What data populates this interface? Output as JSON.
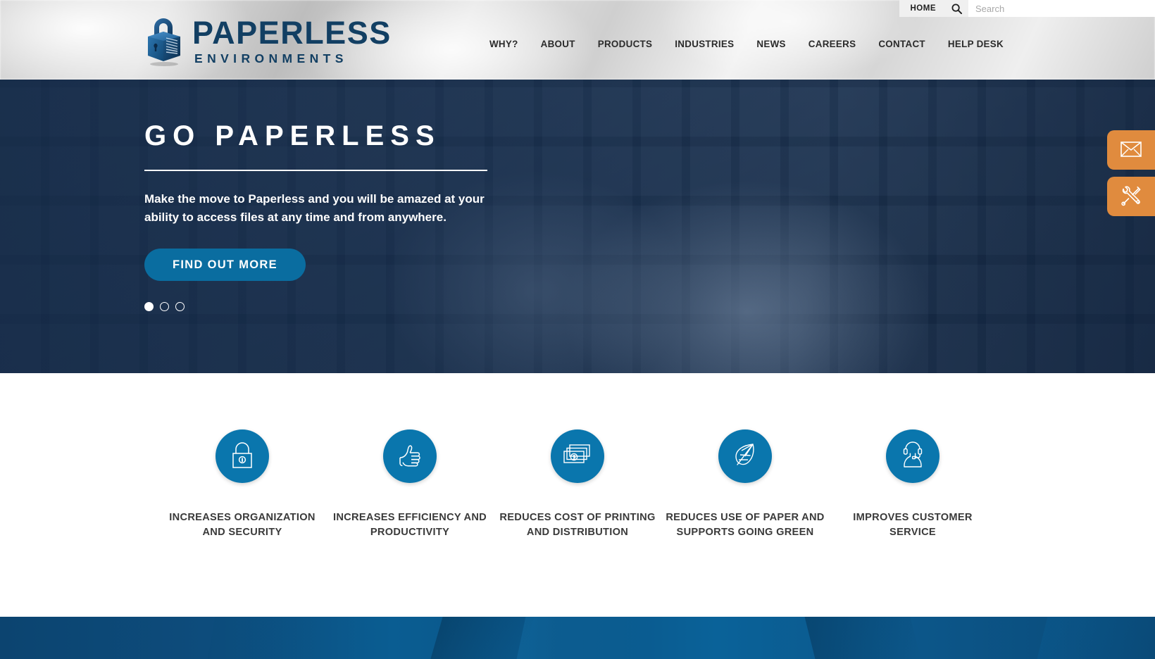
{
  "utility": {
    "home_label": "HOME",
    "search_icon": "search-icon",
    "search_value": "",
    "search_placeholder": "Search"
  },
  "header": {
    "logo": {
      "icon": "padlock-box-logo-icon",
      "title": "PAPERLESS",
      "subtitle": "ENVIRONMENTS"
    },
    "nav": [
      {
        "label": "WHY?"
      },
      {
        "label": "ABOUT"
      },
      {
        "label": "PRODUCTS"
      },
      {
        "label": "INDUSTRIES"
      },
      {
        "label": "NEWS"
      },
      {
        "label": "CAREERS"
      },
      {
        "label": "CONTACT"
      },
      {
        "label": "HELP DESK"
      }
    ]
  },
  "hero": {
    "title": "GO PAPERLESS",
    "description": "Make the move to Paperless and you will be amazed at your ability to access files at any time and from anywhere.",
    "cta_label": "FIND OUT MORE",
    "slides": [
      {
        "active": true
      },
      {
        "active": false
      },
      {
        "active": false
      }
    ]
  },
  "side_tabs": [
    {
      "icon": "envelope-icon",
      "name": "contact-us-tab"
    },
    {
      "icon": "tools-icon",
      "name": "support-tab"
    }
  ],
  "features": [
    {
      "icon": "padlock-icon",
      "label": "INCREASES ORGANIZATION AND SECURITY"
    },
    {
      "icon": "thumbs-up-icon",
      "label": "INCREASES EFFICIENCY AND PRODUCTIVITY"
    },
    {
      "icon": "money-icon",
      "label": "REDUCES COST OF PRINTING AND DISTRIBUTION"
    },
    {
      "icon": "leaf-icon",
      "label": "REDUCES USE OF PAPER AND SUPPORTS GOING GREEN"
    },
    {
      "icon": "headset-person-icon",
      "label": "IMPROVES CUSTOMER SERVICE"
    }
  ],
  "colors": {
    "brand_blue": "#123f63",
    "accent_blue": "#0a76ad",
    "cta_blue": "#0a6da0",
    "accent_orange": "#e08b3e",
    "band_blue": "#0a5486"
  }
}
